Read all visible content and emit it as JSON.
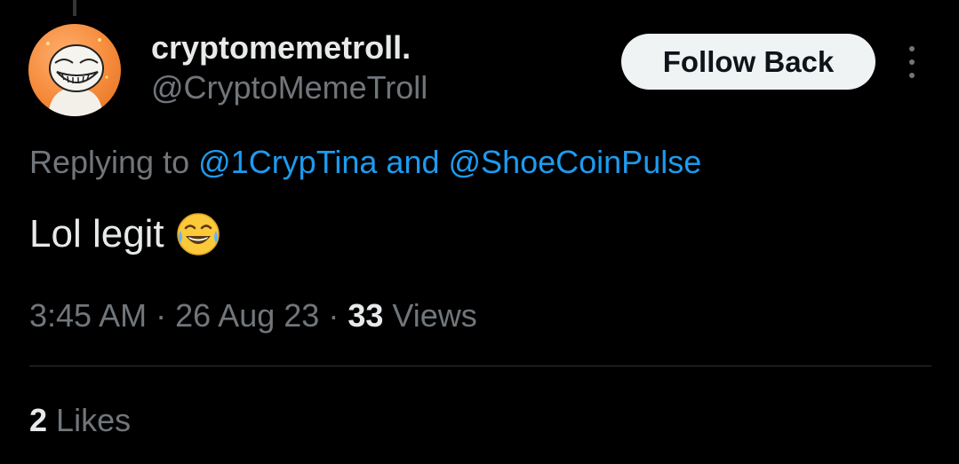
{
  "user": {
    "display_name": "cryptomemetroll.",
    "handle": "@CryptoMemeTroll",
    "avatar_icon": "trollface-avatar"
  },
  "actions": {
    "follow_label": "Follow Back",
    "more_icon": "more-vertical-icon"
  },
  "reply": {
    "prefix": "Replying to",
    "mention_1": "@1CrypTina",
    "conjunction": "and",
    "mention_2": "@ShoeCoinPulse"
  },
  "tweet": {
    "text": "Lol legit",
    "emoji_icon": "face-with-tears-of-joy-emoji"
  },
  "meta": {
    "time": "3:45 AM",
    "separator": "·",
    "date": "26 Aug 23",
    "views_count": "33",
    "views_label": "Views"
  },
  "stats": {
    "likes_count": "2",
    "likes_label": "Likes"
  },
  "colors": {
    "background": "#000000",
    "primary_text": "#e7e9ea",
    "secondary_text": "#71767b",
    "link": "#1d9bf0",
    "button_bg": "#eff3f4",
    "divider": "#2f3336"
  }
}
